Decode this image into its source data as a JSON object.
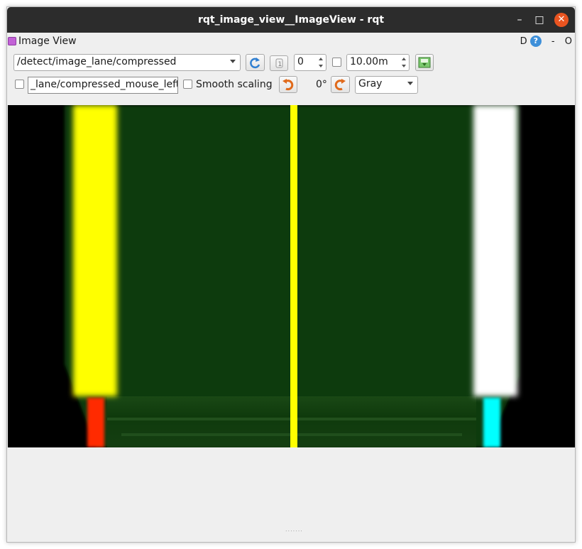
{
  "window": {
    "title": "rqt_image_view__ImageView - rqt",
    "minimize": "–",
    "maximize": "□",
    "close": "✕"
  },
  "dock": {
    "title": "Image View",
    "d_label": "D",
    "help": "?",
    "dash": "-",
    "o_label": "O"
  },
  "toolbar": {
    "topic": "/detect/image_lane/compressed",
    "spin_value": "0",
    "timeout": "10.00m",
    "mouse_topic": "_lane/compressed_mouse_left",
    "smooth_scaling_label": "Smooth scaling",
    "smooth_scaling_checked": false,
    "rotation": "0°",
    "color_scheme": "Gray"
  },
  "icons": {
    "refresh": "refresh-icon",
    "zoom1": "zoom-original-icon",
    "save": "save-image-icon",
    "rotate_left": "rotate-left-icon",
    "rotate_right": "rotate-right-icon"
  },
  "image": {
    "colors": {
      "background": "#000000",
      "lane_area": "#0e3a0b",
      "left_lane": "#ffff00",
      "center_line": "#ffff00",
      "right_lane": "#ffffff",
      "left_marker": "#ff2a00",
      "right_marker": "#00ffff"
    }
  }
}
